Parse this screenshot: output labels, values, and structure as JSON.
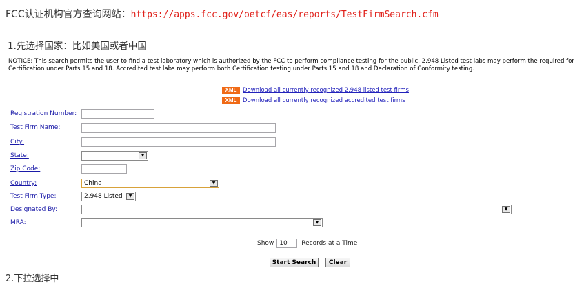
{
  "intro": {
    "prefix": "FCC认证机构官方查询网站：",
    "url": "https://apps.fcc.gov/oetcf/eas/reports/TestFirmSearch.cfm"
  },
  "step1": "1.先选择国家：比如美国或者中国",
  "notice": "NOTICE: This search permits the user to find a test laboratory which is authorized by the FCC to perform compliance testing for the public. 2.948 Listed test labs may perform the required for Certification under Parts 15 and 18. Accredited test labs may perform both Certification testing under Parts 15 and 18 and Declaration of Conformity testing.",
  "downloads": [
    {
      "badge": "XML",
      "label": "Download all currently recognized 2.948 listed test firms"
    },
    {
      "badge": "XML",
      "label": "Download all currently recognized accredited test firms"
    }
  ],
  "form": {
    "registration_number": {
      "label": "Registration Number:",
      "value": ""
    },
    "test_firm_name": {
      "label": "Test Firm Name:",
      "value": ""
    },
    "city": {
      "label": "City:",
      "value": ""
    },
    "state": {
      "label": "State:",
      "value": ""
    },
    "zip_code": {
      "label": "Zip Code:",
      "value": ""
    },
    "country": {
      "label": "Country:",
      "value": "China"
    },
    "test_firm_type": {
      "label": "Test Firm Type:",
      "value": "2.948 Listed"
    },
    "designated_by": {
      "label": "Designated By:",
      "value": ""
    },
    "mra": {
      "label": "MRA:",
      "value": ""
    }
  },
  "show": {
    "prefix": "Show",
    "value": "10",
    "suffix": "Records at a Time"
  },
  "buttons": {
    "search": "Start Search",
    "clear": "Clear"
  },
  "next_step_partial": "2.下拉选择中"
}
